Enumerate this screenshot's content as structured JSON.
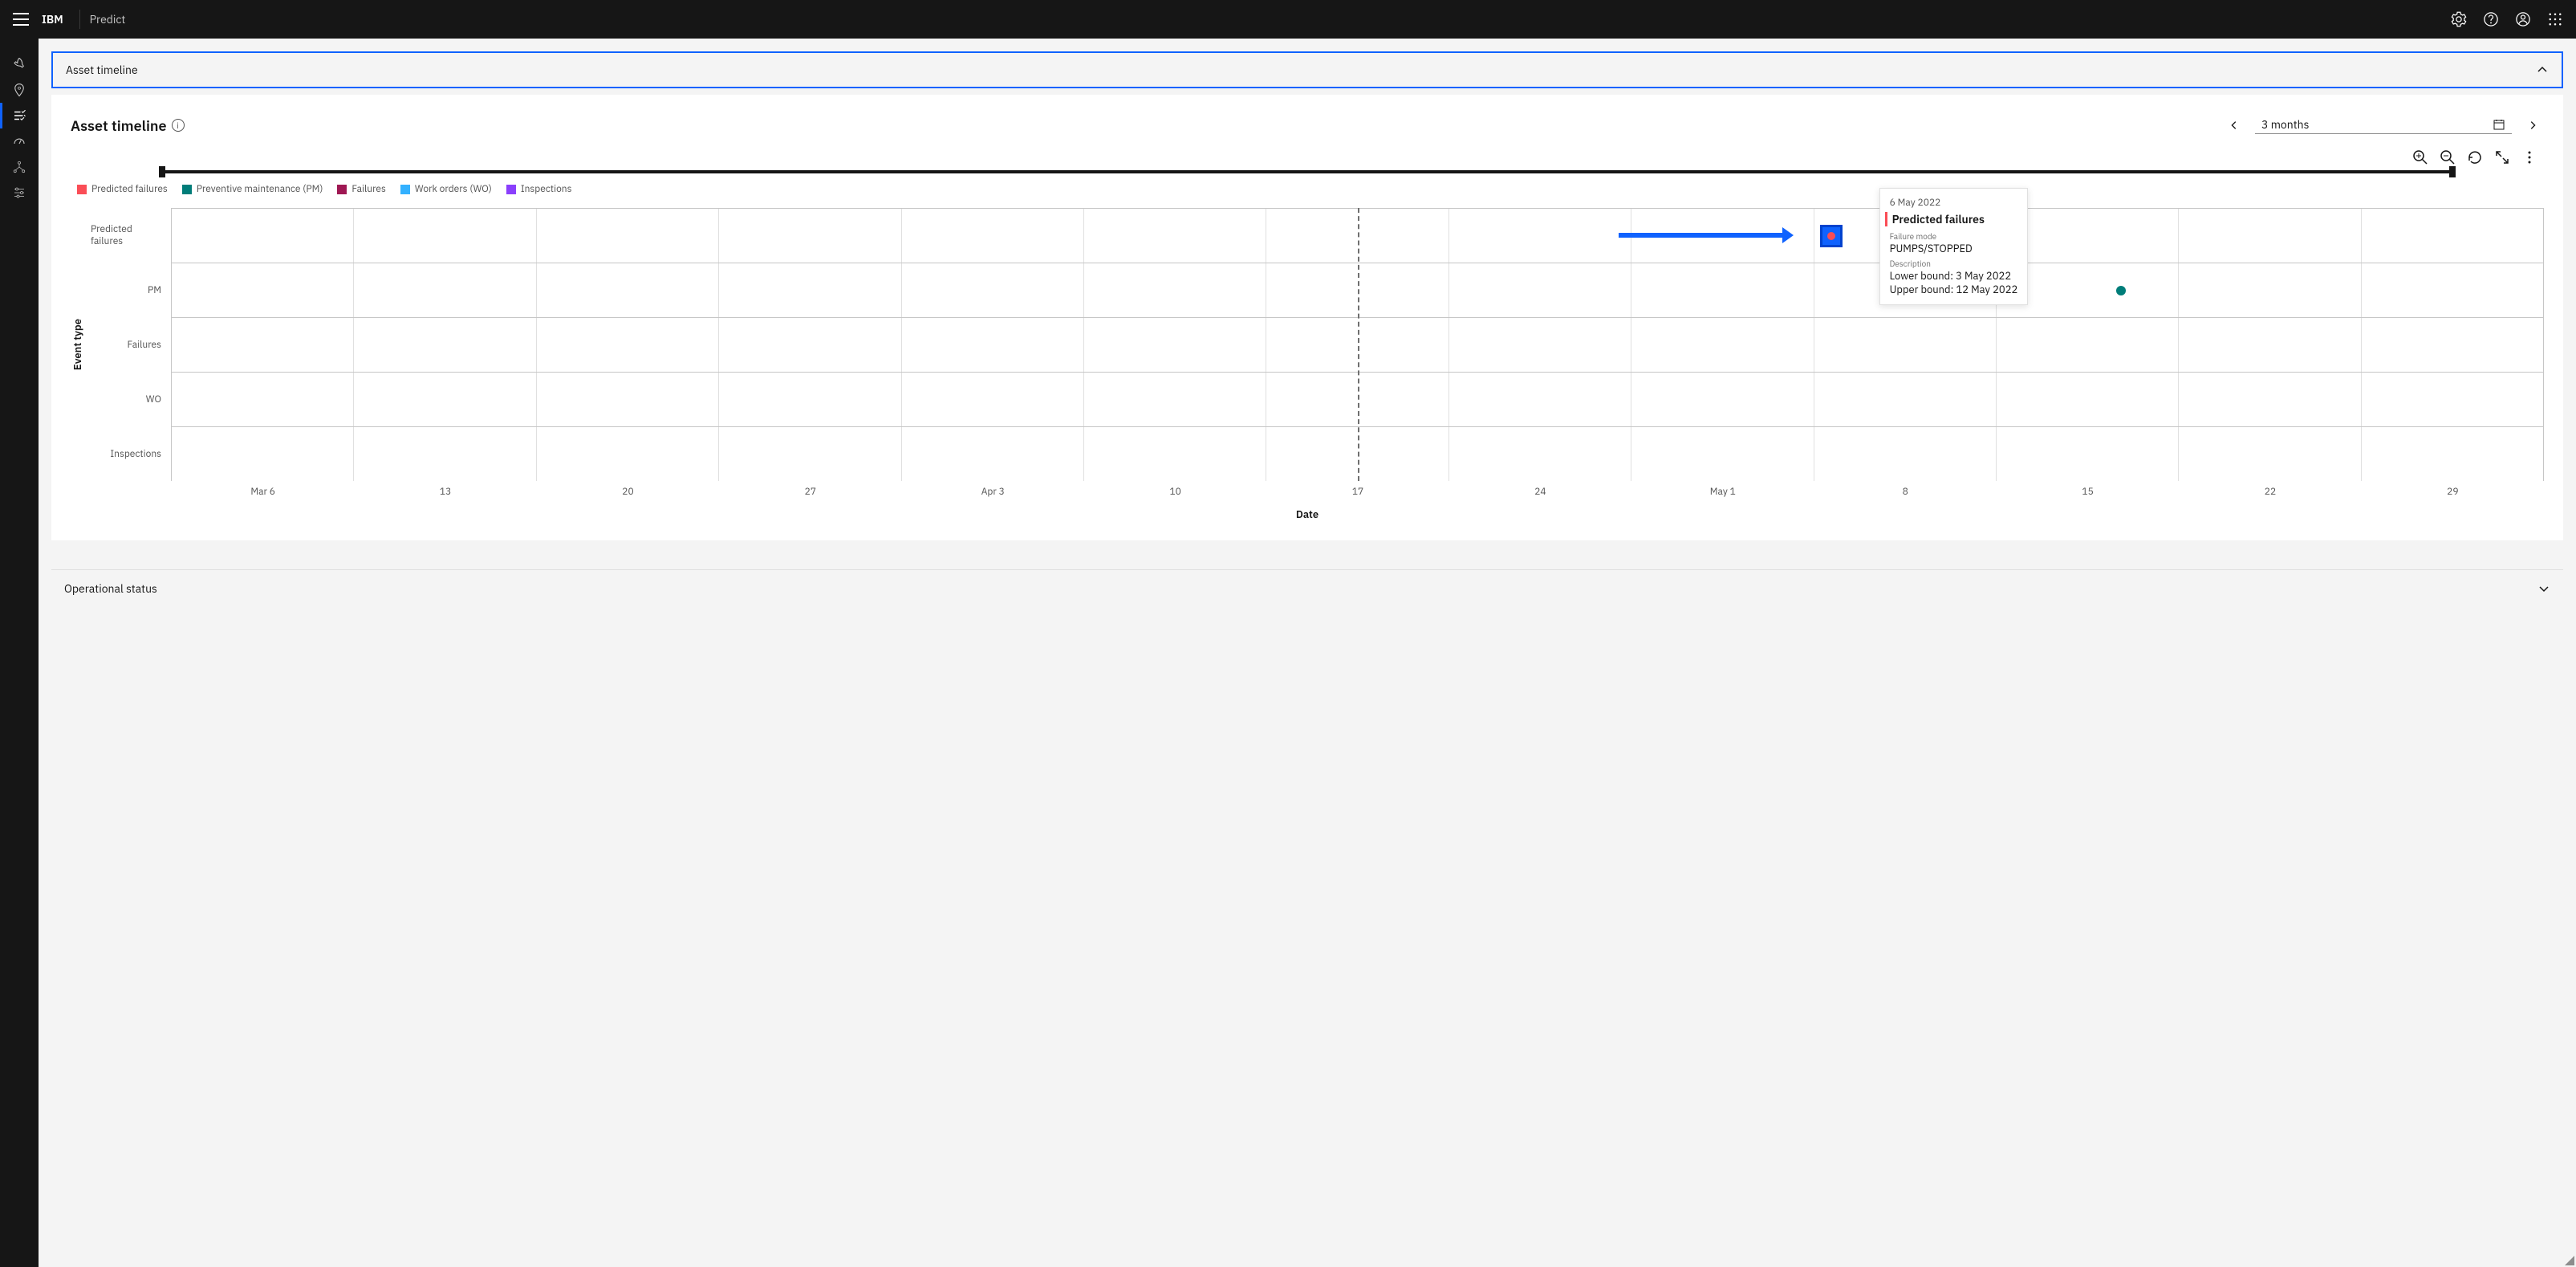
{
  "header": {
    "brand": "IBM",
    "product": "Predict"
  },
  "accordion": {
    "title": "Asset timeline"
  },
  "card": {
    "title": "Asset timeline",
    "range_label": "3 months"
  },
  "legend": [
    {
      "label": "Predicted failures",
      "color": "#fa4d56"
    },
    {
      "label": "Preventive maintenance (PM)",
      "color": "#007d79"
    },
    {
      "label": "Failures",
      "color": "#9f1853"
    },
    {
      "label": "Work orders (WO)",
      "color": "#33b1ff"
    },
    {
      "label": "Inspections",
      "color": "#8a3ffc"
    }
  ],
  "chart_data": {
    "type": "timeline",
    "title": "Asset timeline",
    "xlabel": "Date",
    "ylabel": "Event type",
    "y_categories": [
      "Predicted failures",
      "PM",
      "Failures",
      "WO",
      "Inspections"
    ],
    "x_ticks": [
      "Mar 6",
      "13",
      "20",
      "27",
      "Apr 3",
      "10",
      "17",
      "24",
      "May 1",
      "8",
      "15",
      "22",
      "29"
    ],
    "today_marker": {
      "label": "17",
      "fraction": 0.5
    },
    "events": [
      {
        "row": "Predicted failures",
        "date": "6 May 2022",
        "x_fraction": 0.7,
        "color": "#fa4d56",
        "highlighted": true
      },
      {
        "row": "PM",
        "date": "15 May 2022",
        "x_fraction": 0.82,
        "color": "#007d79"
      }
    ]
  },
  "tooltip": {
    "date": "6 May 2022",
    "title": "Predicted failures",
    "failure_mode_label": "Failure mode",
    "failure_mode": "PUMPS/STOPPED",
    "description_label": "Description",
    "lower": "Lower bound: 3 May 2022",
    "upper": "Upper bound: 12 May 2022"
  },
  "sections": {
    "operational_status": "Operational status"
  }
}
